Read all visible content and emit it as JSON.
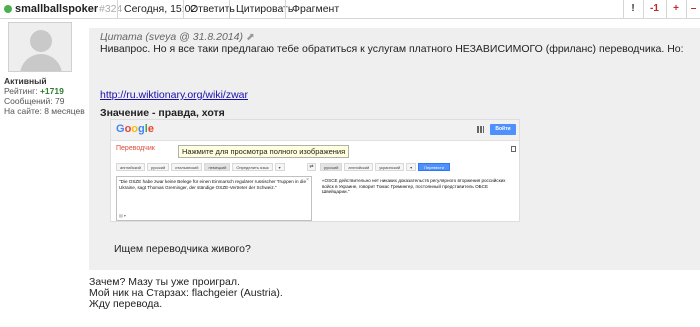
{
  "header": {
    "author": "smallballspoker",
    "post_number": "#324",
    "date": "Сегодня, 15:02",
    "reply_label": "Ответить",
    "quote_label": "Цитировать",
    "fragment_label": "Фрагмент",
    "votes": {
      "warn": "!",
      "minus": "-1",
      "plus": "+",
      "extra": "–"
    },
    "colors": {
      "online": "#4caf50",
      "vote": "#c62828"
    }
  },
  "profile": {
    "status": "Активный",
    "rating_label": "Рейтинг:",
    "rating_value": "+1719",
    "messages": "Сообщений: 79",
    "on_site": "На сайте: 8 месяцев"
  },
  "quote": {
    "header": "Цитата (sveya @ 31.8.2014)",
    "pin_icon": "pin-icon",
    "text": "Нивапрос. Но я все таки предлагаю тебе обратиться к услугам платного НЕЗАВИСИМОГО (фриланс) переводчика. Но:",
    "link": "http://ru.wiktionary.org/wiki/zwar",
    "bold": "Значение - правда, хотя",
    "bottom": "Ищем переводчика живого?"
  },
  "embedded_image": {
    "logo": [
      "G",
      "o",
      "o",
      "g",
      "l",
      "e"
    ],
    "signin": "Войти",
    "title": "Переводчик",
    "tooltip": "Нажмите для просмотра полного изображения",
    "src_langs": [
      "английский",
      "русский",
      "итальянский",
      "немецкий",
      "Определить язык",
      "▾"
    ],
    "dst_langs": [
      "русский",
      "английский",
      "украинский",
      "▾"
    ],
    "translate_button": "Перевести",
    "source_text": "\"Die OSZE habe zwar keine Belege für einen Einmarsch regulärer russischer Truppen in die Ukraine, sagt Thomas Greminger, der ständige OSZE-Vertreter der Schweiz.\"",
    "translated_text": "«OSCE действительно нет никаких доказательств регулярного вторжения российских войск в Украине, говорит Томас Гремингер, постоянный представитель ОБСЕ Швейцарии.\"",
    "keyboard_label": "▤ ▾"
  },
  "body": {
    "lines": [
      "Зачем? Мазу ты уже проиграл.",
      "Мой ник на Старзах: flachgeier (Austria).",
      "Жду перевода."
    ]
  }
}
